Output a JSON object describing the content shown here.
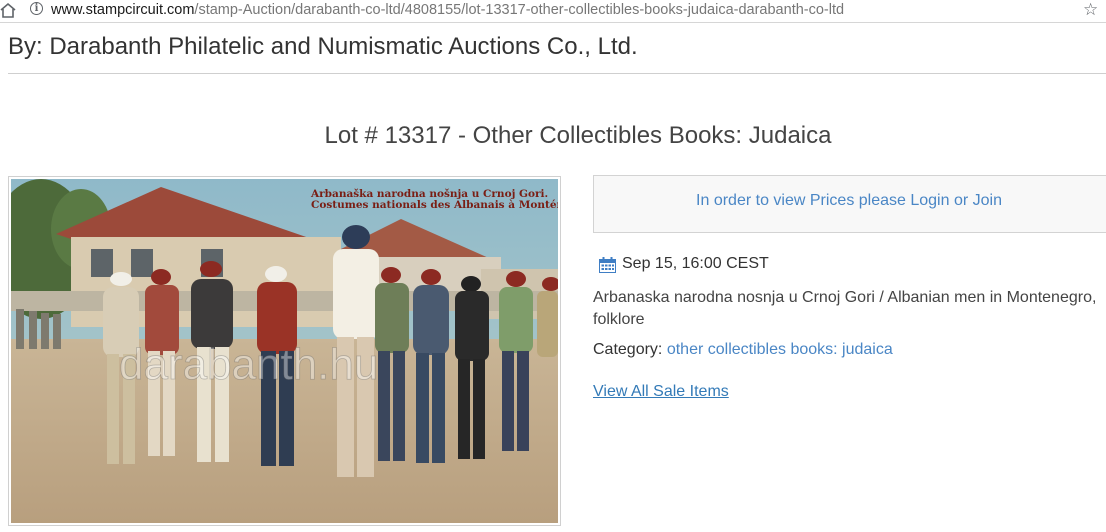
{
  "browser": {
    "url_domain": "www.stampcircuit.com",
    "url_path": "/stamp-Auction/darabanth-co-ltd/4808155/lot-13317-other-collectibles-books-judaica-darabanth-co-ltd"
  },
  "seller": {
    "byline": "By: Darabanth Philatelic and Numismatic Auctions Co., Ltd."
  },
  "lot": {
    "title": "Lot # 13317 - Other Collectibles Books: Judaica",
    "image": {
      "caption_line1": "Arbanaška narodna nošnja u Crnoj Gori.",
      "caption_line2": "Costumes nationals des Albanais à Monténégro.",
      "watermark": "darabanth.hu"
    },
    "price_prompt": "In order to view Prices please Login or Join",
    "date": "Sep 15, 16:00 CEST",
    "description": "Arbanaska narodna nosnja u Crnoj Gori / Albanian men in Montenegro, folklore",
    "category_label": "Category:",
    "category_link1": "other collectibles",
    "category_link2": "books: judaica",
    "view_all": "View All Sale Items"
  },
  "colors": {
    "link": "#4a86c5",
    "text": "#333333"
  },
  "icons": [
    "home-icon",
    "info-icon",
    "star-icon",
    "calendar-icon"
  ]
}
